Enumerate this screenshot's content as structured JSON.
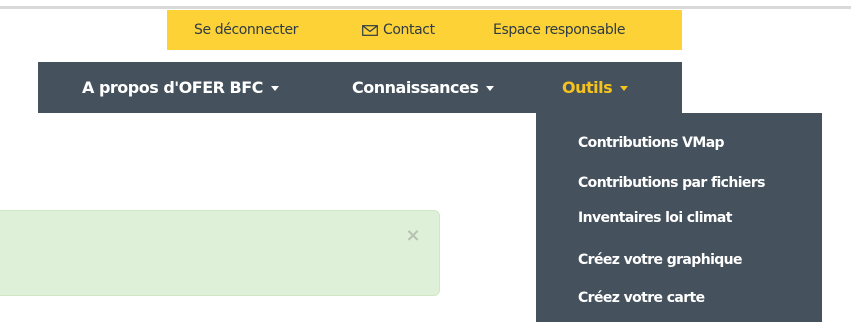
{
  "util_bar": {
    "logout": "Se déconnecter",
    "contact": "Contact",
    "contact_icon": "mail-icon",
    "manager_space": "Espace responsable",
    "background": "#fcd237"
  },
  "main_nav": {
    "background": "#45525d",
    "active_color": "#f5c31d",
    "items": [
      {
        "label": "A propos d'OFER BFC"
      },
      {
        "label": "Connaissances"
      },
      {
        "label": "Outils",
        "active": true
      }
    ]
  },
  "tools_dropdown": {
    "items": [
      {
        "label": "Contributions VMap"
      },
      {
        "label": "Contributions par fichiers"
      },
      {
        "label": "Inventaires loi climat"
      },
      {
        "label": "Créez votre graphique"
      },
      {
        "label": "Créez votre carte"
      }
    ]
  },
  "alert": {
    "close_symbol": "×",
    "background": "#dff0d8"
  }
}
